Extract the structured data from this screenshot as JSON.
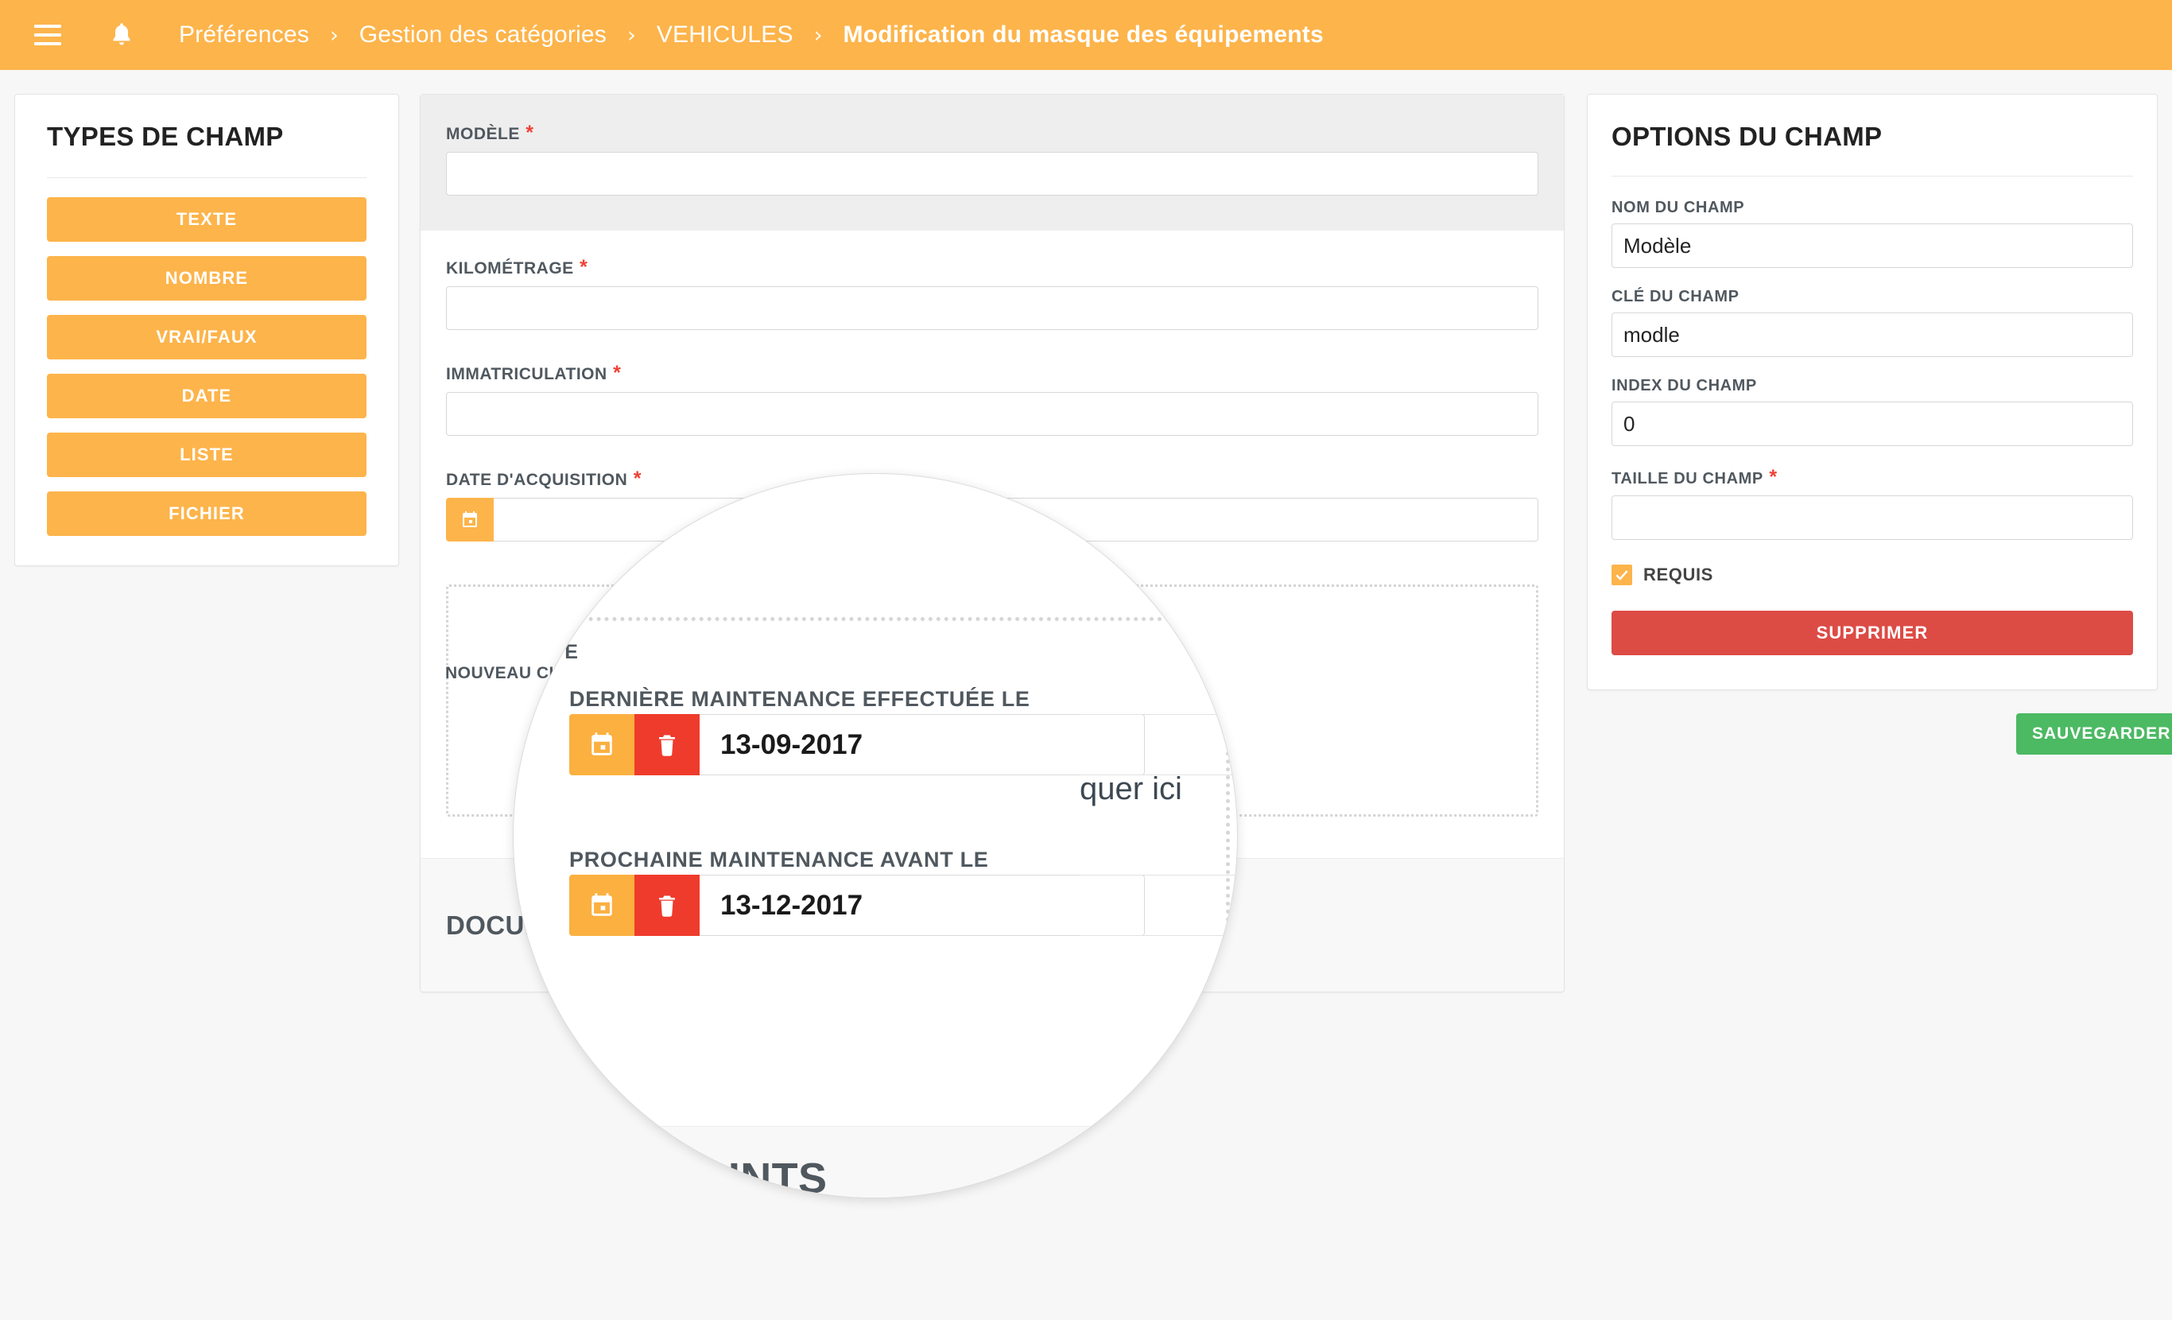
{
  "topbar": {
    "menu_icon": "hamburger-icon",
    "notification_icon": "bell-icon",
    "breadcrumbs": [
      {
        "label": "Préférences",
        "current": false
      },
      {
        "label": "Gestion des catégories",
        "current": false
      },
      {
        "label": "VEHICULES",
        "current": false
      },
      {
        "label": "Modification du masque des équipements",
        "current": true
      }
    ],
    "separator": "›",
    "background_color": "#fdb44b"
  },
  "field_types_panel": {
    "title": "TYPES DE CHAMP",
    "buttons": [
      {
        "label": "TEXTE"
      },
      {
        "label": "NOMBRE"
      },
      {
        "label": "VRAI/FAUX"
      },
      {
        "label": "DATE"
      },
      {
        "label": "LISTE"
      },
      {
        "label": "FICHIER"
      }
    ],
    "button_color": "#fdb44b"
  },
  "form": {
    "fields": [
      {
        "label": "MODÈLE",
        "required": true,
        "value": "",
        "type": "text",
        "selected": true
      },
      {
        "label": "KILOMÉTRAGE",
        "required": true,
        "value": "",
        "type": "text",
        "selected": false
      },
      {
        "label": "IMMATRICULATION",
        "required": true,
        "value": "",
        "type": "text",
        "selected": false
      },
      {
        "label": "DATE D'ACQUISITION",
        "required": true,
        "value": "",
        "type": "date",
        "selected": false
      }
    ],
    "dropzone_label": "NOUVEAU CHAMP",
    "dropzone_hint": "Glisser un type de champ ou cliquer ici",
    "attachments_title": "DOCUMENTS JOINTS"
  },
  "magnifier": {
    "partial_label_left": "NOUVE",
    "partial_text_right": "quer ici",
    "attachments_partial": "DOCUMENTS JOINTS",
    "date_fields": [
      {
        "label": "DERNIÈRE MAINTENANCE EFFECTUÉE LE",
        "value": "13-09-2017",
        "calendar_icon": "calendar-icon",
        "delete_icon": "trash-icon"
      },
      {
        "label": "PROCHAINE MAINTENANCE AVANT LE",
        "value": "13-12-2017",
        "calendar_icon": "calendar-icon",
        "delete_icon": "trash-icon"
      }
    ],
    "calendar_button_color": "#fbb040",
    "delete_button_color": "#ef3b2c"
  },
  "options_panel": {
    "title": "OPTIONS DU CHAMP",
    "fields": [
      {
        "label": "NOM DU CHAMP",
        "value": "Modèle",
        "required": false
      },
      {
        "label": "CLÉ DU CHAMP",
        "value": "modle",
        "required": false
      },
      {
        "label": "INDEX DU CHAMP",
        "value": "0",
        "required": false
      },
      {
        "label": "TAILLE DU CHAMP",
        "value": "",
        "required": true
      }
    ],
    "checkbox": {
      "label": "REQUIS",
      "checked": true,
      "color": "#fdb44b"
    },
    "delete_button": {
      "label": "SUPPRIMER",
      "color": "#dd4b45"
    }
  },
  "save_button": {
    "label": "SAUVEGARDER",
    "color": "#4cb963"
  }
}
